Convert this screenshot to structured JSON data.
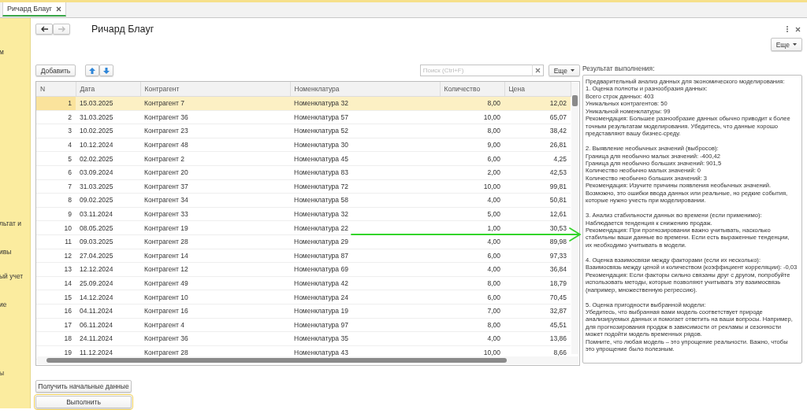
{
  "tab": {
    "label": "Ричард Блауг",
    "selected": true
  },
  "sidebar_fragments": [
    "м",
    "льтат и",
    "ивы",
    "ый учет",
    "ие",
    "ы"
  ],
  "nav_buttons": [
    {
      "kind": "back",
      "disabled": false
    },
    {
      "kind": "forward",
      "disabled": true
    }
  ],
  "title": "Ричард Блауг",
  "top_more_button": "Еще",
  "toolbar": {
    "add_button": "Добавить",
    "move_buttons": [
      {
        "kind": "up"
      },
      {
        "kind": "down"
      }
    ],
    "search": {
      "placeholder": "Поиск (Ctrl+F)"
    },
    "more_button": "Еще"
  },
  "table": {
    "columns": [
      "N",
      "Дата",
      "Контрагент",
      "Номенклатура",
      "Количество",
      "Цена"
    ],
    "rows": [
      {
        "n": "1",
        "date": "15.03.2025",
        "counterparty": "Контрагент 7",
        "item": "Номенклатура 32",
        "qty": "8,00",
        "price": "12,02",
        "selected": true
      },
      {
        "n": "2",
        "date": "31.03.2025",
        "counterparty": "Контрагент 36",
        "item": "Номенклатура 57",
        "qty": "10,00",
        "price": "65,07",
        "selected": false
      },
      {
        "n": "3",
        "date": "10.02.2025",
        "counterparty": "Контрагент 23",
        "item": "Номенклатура 52",
        "qty": "8,00",
        "price": "38,42",
        "selected": false
      },
      {
        "n": "4",
        "date": "10.12.2024",
        "counterparty": "Контрагент 48",
        "item": "Номенклатура 30",
        "qty": "9,00",
        "price": "26,81",
        "selected": false
      },
      {
        "n": "5",
        "date": "02.02.2025",
        "counterparty": "Контрагент 2",
        "item": "Номенклатура 45",
        "qty": "6,00",
        "price": "4,25",
        "selected": false
      },
      {
        "n": "6",
        "date": "03.09.2024",
        "counterparty": "Контрагент 20",
        "item": "Номенклатура 83",
        "qty": "2,00",
        "price": "42,53",
        "selected": false
      },
      {
        "n": "7",
        "date": "31.03.2025",
        "counterparty": "Контрагент 37",
        "item": "Номенклатура 72",
        "qty": "10,00",
        "price": "99,81",
        "selected": false
      },
      {
        "n": "8",
        "date": "09.02.2025",
        "counterparty": "Контрагент 34",
        "item": "Номенклатура 58",
        "qty": "4,00",
        "price": "50,81",
        "selected": false
      },
      {
        "n": "9",
        "date": "03.11.2024",
        "counterparty": "Контрагент 33",
        "item": "Номенклатура 32",
        "qty": "5,00",
        "price": "12,61",
        "selected": false
      },
      {
        "n": "10",
        "date": "08.05.2025",
        "counterparty": "Контрагент 19",
        "item": "Номенклатура 22",
        "qty": "1,00",
        "price": "30,53",
        "selected": false
      },
      {
        "n": "11",
        "date": "09.03.2025",
        "counterparty": "Контрагент 28",
        "item": "Номенклатура 29",
        "qty": "4,00",
        "price": "89,98",
        "selected": false
      },
      {
        "n": "12",
        "date": "27.04.2025",
        "counterparty": "Контрагент 14",
        "item": "Номенклатура 87",
        "qty": "6,00",
        "price": "97,33",
        "selected": false
      },
      {
        "n": "13",
        "date": "12.12.2024",
        "counterparty": "Контрагент 12",
        "item": "Номенклатура 69",
        "qty": "4,00",
        "price": "36,84",
        "selected": false
      },
      {
        "n": "14",
        "date": "25.09.2024",
        "counterparty": "Контрагент 49",
        "item": "Номенклатура 42",
        "qty": "8,00",
        "price": "18,79",
        "selected": false
      },
      {
        "n": "15",
        "date": "14.12.2024",
        "counterparty": "Контрагент 10",
        "item": "Номенклатура 24",
        "qty": "6,00",
        "price": "70,45",
        "selected": false
      },
      {
        "n": "16",
        "date": "04.11.2024",
        "counterparty": "Контрагент 16",
        "item": "Номенклатура 19",
        "qty": "7,00",
        "price": "32,87",
        "selected": false
      },
      {
        "n": "17",
        "date": "06.11.2024",
        "counterparty": "Контрагент 4",
        "item": "Номенклатура 97",
        "qty": "8,00",
        "price": "45,51",
        "selected": false
      },
      {
        "n": "18",
        "date": "24.11.2024",
        "counterparty": "Контрагент 36",
        "item": "Номенклатура 35",
        "qty": "4,00",
        "price": "13,86",
        "selected": false
      },
      {
        "n": "19",
        "date": "11.12.2024",
        "counterparty": "Контрагент 28",
        "item": "Номенклатура 43",
        "qty": "10,00",
        "price": "8,66",
        "selected": false
      }
    ]
  },
  "result": {
    "label": "Результат выполнения:",
    "paragraphs": [
      [
        "Предварительный анализ данных для экономического моделирования:",
        "1. Оценка полноты и разнообразия данных:",
        "Всего строк данных: 403",
        "Уникальных контрагентов: 50",
        "Уникальной номенклатуры: 99",
        "Рекомендация: Большее разнообразие данных обычно приводит к более",
        "точным результатам моделирования. Убедитесь, что данные хорошо",
        "представляют вашу бизнес-среду."
      ],
      [
        "2. Выявление необычных значений (выбросов):",
        "Граница для необычно малых значений: -400,42",
        "Граница для необычно больших значений: 901,5",
        "Количество необычно малых значений: 0",
        "Количество необычно больших значений: 3",
        "Рекомендация: Изучите причины появления необычных значений.",
        "Возможно, это ошибки ввода данных или реальные, но редкие события,",
        "которые нужно учесть при моделировании."
      ],
      [
        "3. Анализ стабильности данных во времени (если применимо):",
        "Наблюдается тенденция к снижению продаж.",
        "Рекомендация: При прогнозировании важно учитывать, насколько",
        "стабильны ваши данные во времени. Если есть выраженные тенденции,",
        "их необходимо учитывать в модели."
      ],
      [
        "4. Оценка взаимосвязи между факторами (если их несколько):",
        "Взаимосвязь между ценой и количеством (коэффициент корреляции): -0,03",
        "Рекомендация: Если факторы сильно связаны друг с другом, попробуйте",
        "использовать методы, которые позволяют учитывать эту взаимосвязь",
        "(например, множественную регрессию)."
      ],
      [
        "5. Оценка пригодности выбранной модели:",
        "Убедитесь, что выбранная вами модель соответствует природе",
        "анализируемых данных и помогает ответить на ваши вопросы. Например,",
        "для прогнозирования продаж в зависимости от рекламы и сезонности",
        "может подойти модель временных рядов.",
        "Помните, что любая модель – это упрощение реальности. Важно, чтобы",
        "это упрощение было полезным."
      ]
    ]
  },
  "buttons": [
    {
      "label": "Получить начальные данные",
      "default": false
    },
    {
      "label": "Выполнить",
      "default": true
    }
  ]
}
